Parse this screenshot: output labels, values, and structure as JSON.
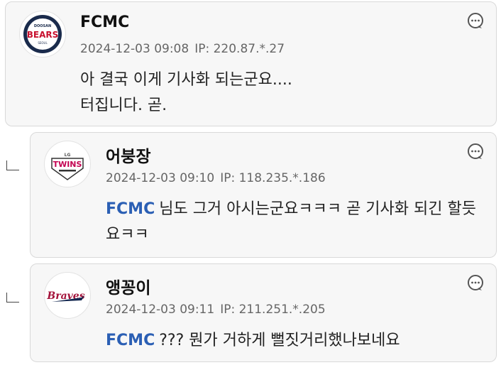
{
  "comments": [
    {
      "avatar_team": "DOOSAN BEARS",
      "nickname": "FCMC",
      "date": "2024-12-03 09:08",
      "ip": "IP: 220.87.*.27",
      "mention": "",
      "text": "아 결국 이게 기사화 되는군요....\n터집니다. 곧."
    },
    {
      "avatar_team": "LG TWINS",
      "nickname": "어붕장",
      "date": "2024-12-03 09:10",
      "ip": "IP: 118.235.*.186",
      "mention": "FCMC",
      "text": "님도 그거 아시는군요ㅋㅋㅋ 곧 기사화 되긴 할듯요ㅋㅋ"
    },
    {
      "avatar_team": "Braves",
      "nickname": "앵꽁이",
      "date": "2024-12-03 09:11",
      "ip": "IP: 211.251.*.205",
      "mention": "FCMC",
      "text": "??? 뭔가 거하게 뻘짓거리했나보네요"
    }
  ],
  "icons": {
    "reply": "comment-bubble-icon",
    "reply_indicator": "reply-arrow-icon"
  },
  "colors": {
    "mention": "#2b5fb4",
    "card_bg": "#f7f7f7",
    "meta": "#666666"
  }
}
